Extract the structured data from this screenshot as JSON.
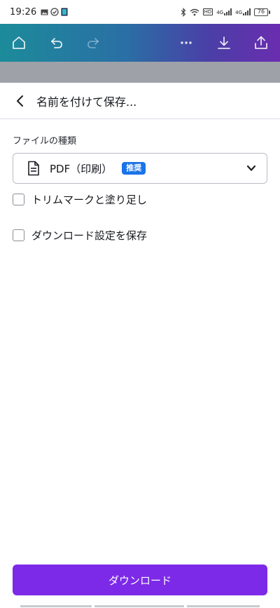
{
  "status_bar": {
    "time": "19:26",
    "hd_label": "HD",
    "signal_1": "4G",
    "signal_2": "4G",
    "battery": "76"
  },
  "toolbar": {
    "icons": [
      "home-icon",
      "undo-icon",
      "redo-icon",
      "more-icon",
      "download-icon",
      "share-icon"
    ]
  },
  "sheet": {
    "title": "名前を付けて保存...",
    "file_type_label": "ファイルの種類",
    "file_type": {
      "value": "PDF（印刷）",
      "badge": "推奨"
    },
    "options": [
      {
        "label": "トリムマークと塗り足し",
        "checked": false
      },
      {
        "label": "ダウンロード設定を保存",
        "checked": false
      }
    ],
    "download_button": "ダウンロード"
  },
  "colors": {
    "accent": "#7d2ae8",
    "badge": "#1a73e8",
    "toolbar_gradient_start": "#1c8b9a",
    "toolbar_gradient_end": "#6a2db0"
  }
}
